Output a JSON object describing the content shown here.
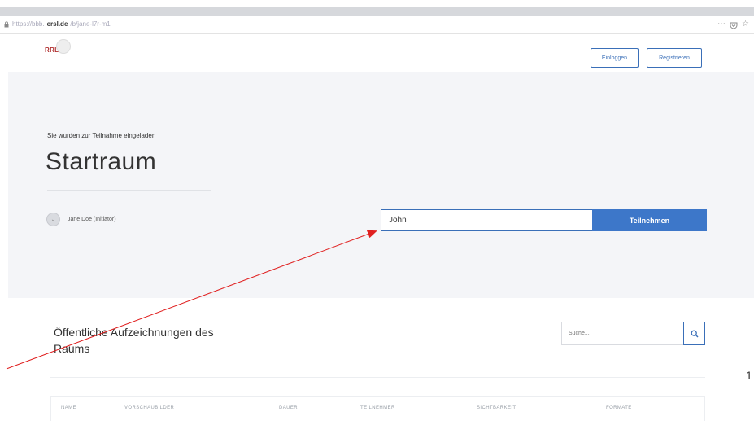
{
  "browser": {
    "url_prefix": "https://bbb.",
    "url_host": "ersl.de",
    "url_path": "/b/jane-l7r-m1l",
    "more_icon": "ellipsis-icon",
    "pocket_icon": "pocket-icon",
    "bookmark_icon": "star-icon"
  },
  "header": {
    "logo_text": "RRL",
    "login_label": "Einloggen",
    "register_label": "Registrieren"
  },
  "hero": {
    "invited_text": "Sie wurden zur Teilnahme eingeladen",
    "room_name": "Startraum",
    "owner_initial": "J",
    "owner_name": "Jane Doe (Initiator)",
    "name_value": "John",
    "join_label": "Teilnehmen"
  },
  "annotation": {
    "label": "1",
    "color": "#e02020"
  },
  "recordings": {
    "title": "Öffentliche Aufzeichnungen des Raums",
    "search_placeholder": "Suche...",
    "columns": [
      "NAME",
      "VORSCHAUBILDER",
      "DAUER",
      "TEILNEHMER",
      "SICHTBARKEIT",
      "FORMATE"
    ]
  },
  "colors": {
    "accent": "#3d77c9",
    "hero_bg": "#f4f5f8"
  }
}
